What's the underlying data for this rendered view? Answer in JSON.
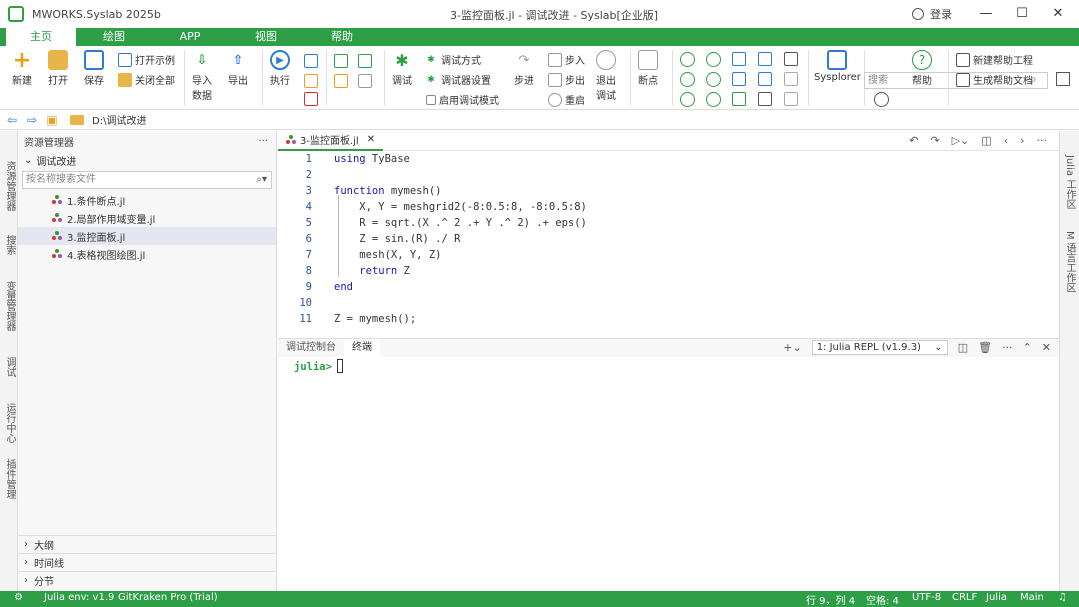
{
  "titlebar": {
    "app_title": "MWORKS.Syslab 2025b",
    "doc_title": "3-监控面板.jl - 调试改进 - Syslab[企业版]",
    "login": "登录"
  },
  "menubar": {
    "tabs": [
      "主页",
      "绘图",
      "APP",
      "视图",
      "帮助"
    ]
  },
  "ribbon": {
    "new_label": "新建",
    "open_label": "打开",
    "save_label": "保存",
    "open_example": "打开示例",
    "close_all": "关闭全部",
    "import_label": "导入\n数据",
    "export_label": "导出",
    "run_label": "执行",
    "debug_label": "调试",
    "debug_with": "调试方式",
    "debug_settings": "调试器设置",
    "step_mode": "启用调试模式",
    "step_label": "步进",
    "step_in": "步入",
    "step_out": "步出",
    "restart": "重启",
    "exit_debug": "退出\n调试",
    "breakpoints": "断点",
    "sysplorer": "Sysplorer",
    "help": "帮助",
    "new_help_project": "新建帮助工程",
    "gen_help_doc": "生成帮助文档",
    "search_placeholder": "搜索"
  },
  "address": {
    "path": "D:\\调试改进"
  },
  "explorer": {
    "header": "资源管理器",
    "folder": "调试改进",
    "search_placeholder": "按名称搜索文件",
    "files": [
      "1.条件断点.jl",
      "2.局部作用域变量.jl",
      "3.监控面板.jl",
      "4.表格视图绘图.jl"
    ],
    "bottom": [
      "大纲",
      "时间线",
      "分节"
    ]
  },
  "leftstrip": {
    "labels": [
      "资源管理器",
      "搜索",
      "变量管理器",
      "调试",
      "运行中心",
      "插件管理"
    ]
  },
  "rightstrip": {
    "labels": [
      "Julia 工作区",
      "M 语言工作区"
    ]
  },
  "editor": {
    "tab": "3-监控面板.jl",
    "lines": [
      {
        "n": "1",
        "t": "using TyBase"
      },
      {
        "n": "2",
        "t": ""
      },
      {
        "n": "3",
        "t": "function mymesh()"
      },
      {
        "n": "4",
        "t": "    X, Y = meshgrid2(-8:0.5:8, -8:0.5:8)"
      },
      {
        "n": "5",
        "t": "    R = sqrt.(X .^ 2 .+ Y .^ 2) .+ eps()"
      },
      {
        "n": "6",
        "t": "    Z = sin.(R) ./ R"
      },
      {
        "n": "7",
        "t": "    mesh(X, Y, Z)"
      },
      {
        "n": "8",
        "t": "    return Z"
      },
      {
        "n": "9",
        "t": "end"
      },
      {
        "n": "10",
        "t": ""
      },
      {
        "n": "11",
        "t": "Z = mymesh();"
      }
    ]
  },
  "terminal": {
    "tabs": [
      "调试控制台",
      "终端"
    ],
    "repl": "1: Julia REPL (v1.9.3)",
    "prompt": "julia>"
  },
  "statusbar": {
    "env": "Julia env: v1.9",
    "gitkraken": "GitKraken Pro (Trial)",
    "position": "行 9，列 4",
    "spaces": "空格: 4",
    "encoding": "UTF-8",
    "eol": "CRLF",
    "lang": "Julia",
    "branch": "Main"
  },
  "colors": {
    "accent": "#2e9e47"
  }
}
